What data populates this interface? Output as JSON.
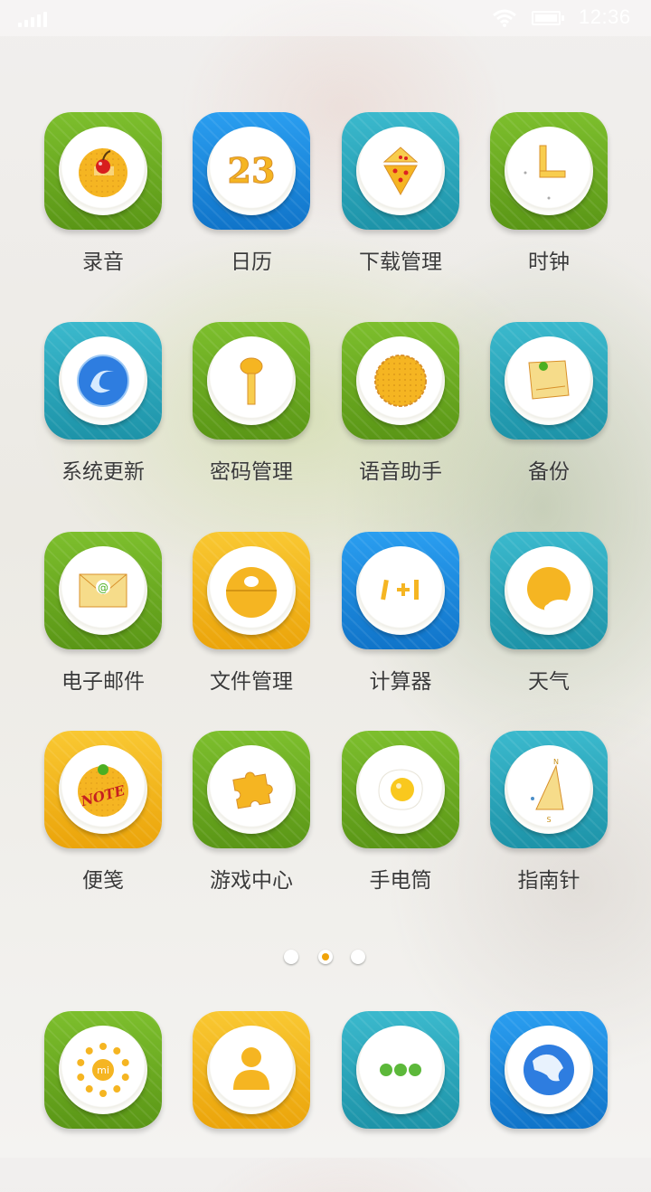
{
  "status_bar": {
    "time": "12:36"
  },
  "apps": [
    {
      "label": "录音",
      "color": "green",
      "icon": "cherry-cookie-icon"
    },
    {
      "label": "日历",
      "color": "blue",
      "icon": "calendar-biscuit-icon",
      "text": "23"
    },
    {
      "label": "下载管理",
      "color": "teal",
      "icon": "pizza-slices-icon"
    },
    {
      "label": "时钟",
      "color": "green",
      "icon": "biscuit-clock-icon"
    },
    {
      "label": "系统更新",
      "color": "teal",
      "icon": "swirl-candy-icon"
    },
    {
      "label": "密码管理",
      "color": "green",
      "icon": "biscuit-key-icon"
    },
    {
      "label": "语音助手",
      "color": "green",
      "icon": "waffle-cookie-icon"
    },
    {
      "label": "备份",
      "color": "teal",
      "icon": "cheese-note-icon"
    },
    {
      "label": "电子邮件",
      "color": "green",
      "icon": "envelope-cracker-icon"
    },
    {
      "label": "文件管理",
      "color": "yellow",
      "icon": "egg-yolk-folder-icon"
    },
    {
      "label": "计算器",
      "color": "blue",
      "icon": "stick-calculation-icon"
    },
    {
      "label": "天气",
      "color": "teal",
      "icon": "sun-cloud-icon"
    },
    {
      "label": "便笺",
      "color": "yellow",
      "icon": "note-cookie-icon",
      "text": "NOTE"
    },
    {
      "label": "游戏中心",
      "color": "green",
      "icon": "puzzle-biscuit-icon"
    },
    {
      "label": "手电筒",
      "color": "green",
      "icon": "fried-egg-icon"
    },
    {
      "label": "指南针",
      "color": "teal",
      "icon": "sandwich-compass-icon",
      "text_n": "N",
      "text_s": "S"
    }
  ],
  "page_indicator": {
    "count": 3,
    "active": 2
  },
  "dock": [
    {
      "color": "green",
      "icon": "dial-pad-icon",
      "text": "mi"
    },
    {
      "color": "yellow",
      "icon": "contact-person-icon"
    },
    {
      "color": "teal",
      "icon": "message-dots-icon"
    },
    {
      "color": "blue",
      "icon": "globe-browser-icon"
    }
  ],
  "colors": {
    "green": "#6cac22",
    "blue": "#1687de",
    "teal": "#2aa9bd",
    "yellow": "#f3b716",
    "accent": "#f0a30a"
  }
}
